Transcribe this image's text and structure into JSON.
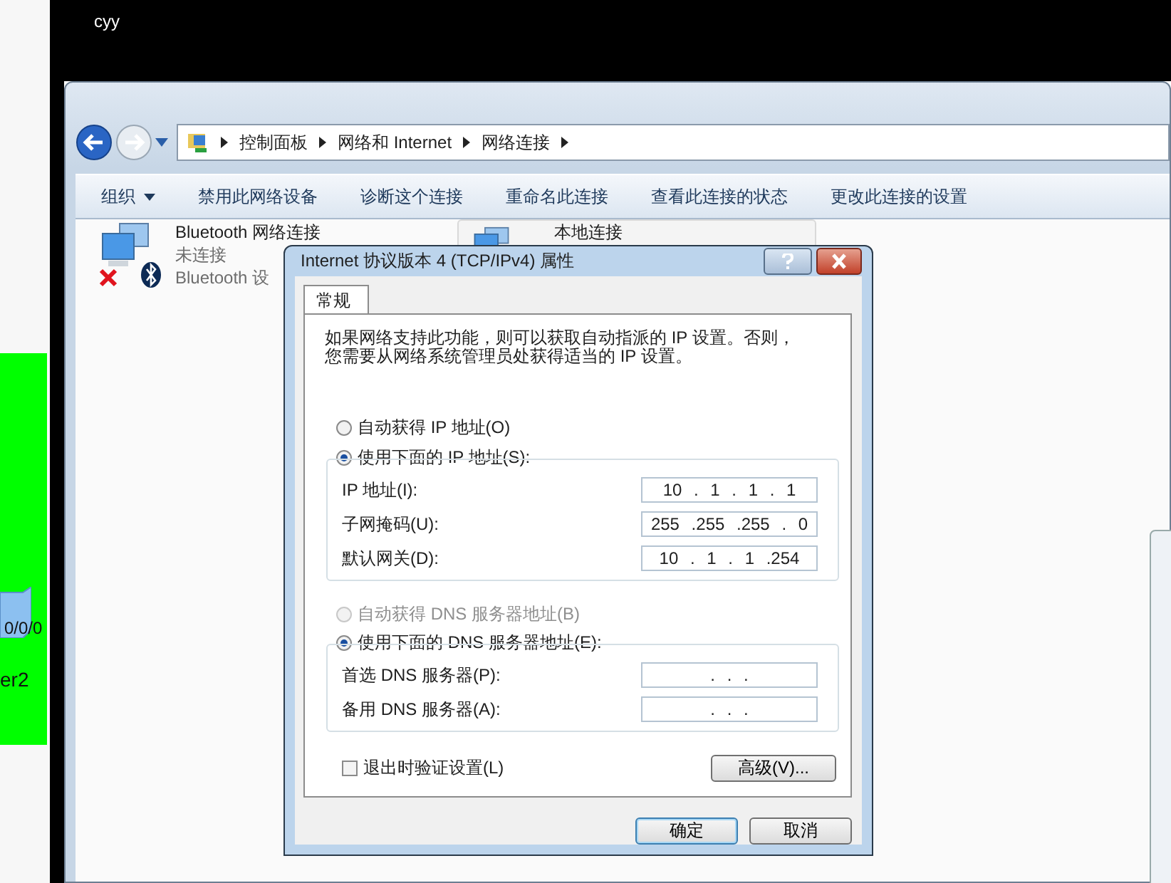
{
  "desktop": {
    "user_label": "cyy"
  },
  "background_app": {
    "port_label": "0/0/0",
    "device_label": "er2"
  },
  "explorer": {
    "breadcrumb": [
      "控制面板",
      "网络和 Internet",
      "网络连接"
    ],
    "toolbar": [
      {
        "label": "组织",
        "kind": "menu"
      },
      {
        "label": "禁用此网络设备",
        "kind": "command"
      },
      {
        "label": "诊断这个连接",
        "kind": "command"
      },
      {
        "label": "重命名此连接",
        "kind": "command"
      },
      {
        "label": "查看此连接的状态",
        "kind": "command"
      },
      {
        "label": "更改此连接的设置",
        "kind": "command"
      }
    ],
    "connections": [
      {
        "name": "Bluetooth 网络连接",
        "status": "未连接",
        "device": "Bluetooth 设",
        "disconnected": true,
        "kind": "bluetooth"
      },
      {
        "name": "本地连接",
        "kind": "local"
      }
    ]
  },
  "dialog": {
    "title": "Internet 协议版本 4 (TCP/IPv4) 属性",
    "tabs": [
      {
        "label": "常规",
        "selected": true
      }
    ],
    "description": [
      "如果网络支持此功能，则可以获取自动指派的 IP 设置。否则，",
      "您需要从网络系统管理员处获得适当的 IP 设置。"
    ],
    "ip_mode": [
      {
        "label": "自动获得 IP 地址(O)",
        "selected": false,
        "disabled": false
      },
      {
        "label": "使用下面的 IP 地址(S):",
        "selected": true,
        "disabled": false
      }
    ],
    "ip_fields": [
      {
        "label": "IP 地址(I):",
        "value": "10 . 1 . 1 . 1"
      },
      {
        "label": "子网掩码(U):",
        "value": "255 .255 .255 . 0"
      },
      {
        "label": "默认网关(D):",
        "value": "10 . 1 . 1 .254"
      }
    ],
    "dns_mode": [
      {
        "label": "自动获得 DNS 服务器地址(B)",
        "selected": false,
        "disabled": true
      },
      {
        "label": "使用下面的 DNS 服务器地址(E):",
        "selected": true,
        "disabled": false
      }
    ],
    "dns_fields": [
      {
        "label": "首选 DNS 服务器(P):",
        "value": ". . ."
      },
      {
        "label": "备用 DNS 服务器(A):",
        "value": ". . ."
      }
    ],
    "validate_on_exit": {
      "label": "退出时验证设置(L)",
      "checked": false
    },
    "advanced_button": "高级(V)...",
    "buttons": [
      {
        "label": "确定",
        "default": true
      },
      {
        "label": "取消",
        "default": false
      }
    ]
  }
}
